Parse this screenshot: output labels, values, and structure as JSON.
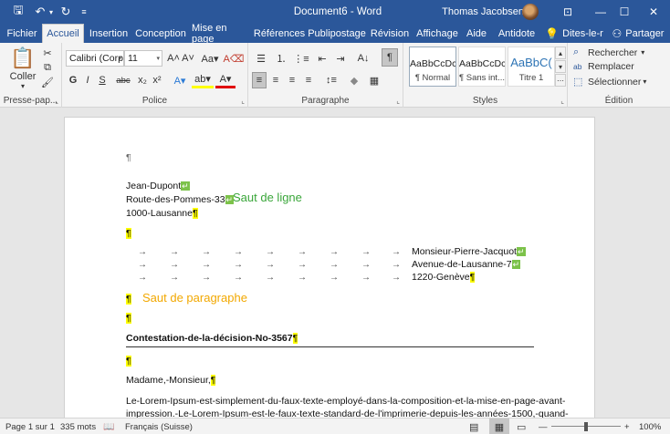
{
  "window": {
    "title": "Document6  -  Word",
    "user": "Thomas Jacobsen",
    "qat": {
      "save": "🖫",
      "undo": "↶",
      "undo_dd": "▾",
      "redo": "↻",
      "customize": "≡"
    },
    "controls": {
      "ribbon_options": "⊡",
      "minimize": "—",
      "maximize": "☐",
      "close": "✕"
    }
  },
  "tabs": [
    {
      "label": "Fichier"
    },
    {
      "label": "Accueil"
    },
    {
      "label": "Insertion"
    },
    {
      "label": "Conception"
    },
    {
      "label": "Mise en page"
    },
    {
      "label": "Références"
    },
    {
      "label": "Publipostage"
    },
    {
      "label": "Révision"
    },
    {
      "label": "Affichage"
    },
    {
      "label": "Aide"
    },
    {
      "label": "Antidote"
    },
    {
      "label": "Dites-le-r"
    },
    {
      "label": "Partager"
    }
  ],
  "tab_icons": {
    "tell_me": "💡",
    "share": "⚇"
  },
  "ribbon": {
    "clipboard": {
      "label": "Presse-pap...",
      "paste": "Coller",
      "paste_dd": "▾",
      "cut": "✂",
      "copy": "⧉",
      "painter": "🖌"
    },
    "font": {
      "label": "Police",
      "name": "Calibri (Corp",
      "size": "11",
      "grow": "A˄",
      "shrink": "A˅",
      "case": "Aa▾",
      "clear": "A⌫",
      "bold": "G",
      "italic": "I",
      "underline": "S",
      "strike": "abc",
      "sub": "x₂",
      "sup": "x²",
      "effects": "A▾",
      "highlight": "ab▾",
      "color": "A▾"
    },
    "paragraph": {
      "label": "Paragraphe",
      "bullets": "☰",
      "numbering": "⒈",
      "multilevel": "⋮≡",
      "outdent": "⇤",
      "indent": "⇥",
      "sort": "A↓",
      "pilcrow": "¶",
      "align": [
        "≡",
        "≡",
        "≡",
        "≡"
      ],
      "spacing": "↕≡",
      "shading": "◆",
      "borders": "▦"
    },
    "styles": {
      "label": "Styles",
      "items": [
        {
          "sample": "AaBbCcDc",
          "name": "¶ Normal"
        },
        {
          "sample": "AaBbCcDc",
          "name": "¶ Sans int..."
        },
        {
          "sample": "AaBbC(",
          "name": "Titre 1"
        }
      ],
      "scroll": {
        "up": "▴",
        "down": "▾",
        "more": "⋯"
      }
    },
    "editing": {
      "label": "Édition",
      "find": "Rechercher",
      "find_dd": "▾",
      "find_icon": "⌕",
      "replace": "Remplacer",
      "replace_icon": "ab",
      "select": "Sélectionner",
      "select_dd": "▾",
      "select_icon": "⬚"
    },
    "launcher_glyph": "⌞"
  },
  "document": {
    "marks": {
      "pilcrow": "¶",
      "line_break": "↵",
      "tab": "→"
    },
    "sender": {
      "name": "Jean-Dupont",
      "street": "Route-des-Pommes-33",
      "city": "1000-Lausanne"
    },
    "recipient": {
      "name": "Monsieur-Pierre-Jacquot",
      "street": "Avenue-de-Lausanne-7",
      "city": "1220-Genève"
    },
    "annotation_line": "Saut de ligne",
    "annotation_paragraph": "Saut de paragraphe",
    "subject": "Contestation-de-la-décision-No-3567",
    "greeting": "Madame,-Monsieur,",
    "body_1": "Le-Lorem-Ipsum-est-simplement-du-faux-texte-employé-dans-la-composition-et-la-mise-en-page-avant-",
    "body_2": "impression.-Le-Lorem-Ipsum-est-le-faux-texte-standard-de-l'imprimerie-depuis-les-années-1500,-quand-"
  },
  "status": {
    "page": "Page 1 sur 1",
    "words": "335 mots",
    "proof_icon": "📖",
    "language": "Français (Suisse)",
    "views": {
      "read": "▤",
      "print": "▦",
      "web": "▭"
    },
    "zoom_minus": "—",
    "zoom_plus": "+",
    "zoom": "100%",
    "zoom_level": 100
  },
  "colors": {
    "accent": "#2b579a",
    "highlight": "#ffff00",
    "break_mark": "#7cc24a",
    "annot_green": "#3aa63a",
    "annot_orange": "#f2a800"
  }
}
